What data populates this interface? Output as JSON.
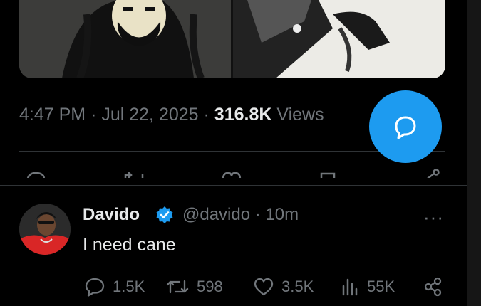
{
  "tweet": {
    "time": "4:47 PM",
    "date": "Jul 22, 2025",
    "views_count": "316.8K",
    "views_label": "Views"
  },
  "reply": {
    "name": "Davido",
    "handle": "@davido",
    "age": "10m",
    "text": "I need cane",
    "replies": "1.5K",
    "reposts": "598",
    "likes": "3.5K",
    "views": "55K"
  },
  "colors": {
    "accent": "#1d9bf0",
    "muted": "#71767b",
    "text": "#e7e9ea",
    "background": "#000000"
  }
}
